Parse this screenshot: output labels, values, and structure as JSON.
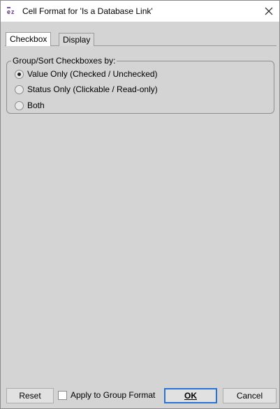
{
  "window": {
    "title": "Cell Format for 'Is a Database Link'"
  },
  "tabs": [
    {
      "label": "Checkbox",
      "active": true
    },
    {
      "label": "Display",
      "active": false
    }
  ],
  "group": {
    "label": "Group/Sort Checkboxes by:",
    "options": [
      {
        "label": "Value Only (Checked / Unchecked)",
        "checked": true
      },
      {
        "label": "Status Only (Clickable / Read-only)",
        "checked": false
      },
      {
        "label": "Both",
        "checked": false
      }
    ]
  },
  "footer": {
    "reset_label": "Reset",
    "apply_label": "Apply to Group Format",
    "apply_checked": false,
    "ok_label": "OK",
    "cancel_label": "Cancel"
  },
  "icons": {
    "app": "app-logo-icon",
    "close": "close-icon"
  },
  "colors": {
    "dialog_bg": "#d4d4d4",
    "default_button_border": "#2a73d6"
  }
}
